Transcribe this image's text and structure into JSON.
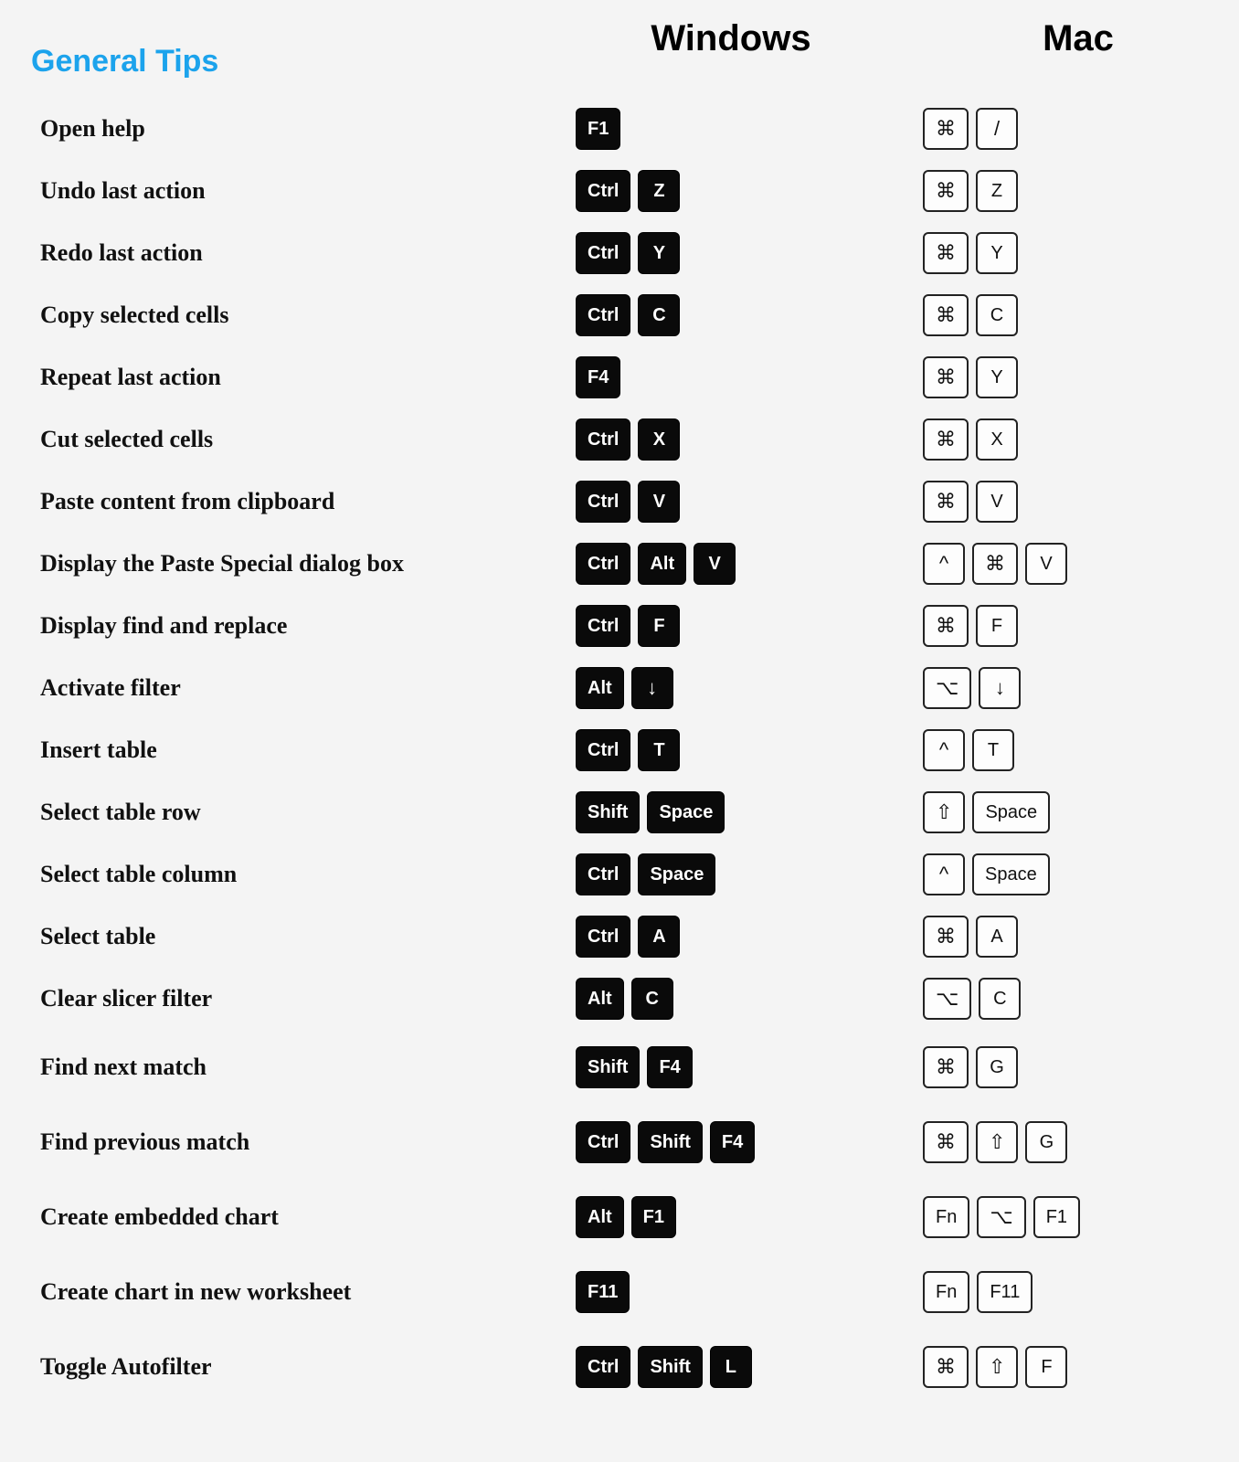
{
  "headers": {
    "section": "General Tips",
    "windows": "Windows",
    "mac": "Mac"
  },
  "rows": [
    {
      "label": "Open help",
      "win": [
        "F1"
      ],
      "mac": [
        "⌘",
        "/"
      ]
    },
    {
      "label": "Undo last action",
      "win": [
        "Ctrl",
        "Z"
      ],
      "mac": [
        "⌘",
        "Z"
      ]
    },
    {
      "label": "Redo last action",
      "win": [
        "Ctrl",
        "Y"
      ],
      "mac": [
        "⌘",
        "Y"
      ]
    },
    {
      "label": "Copy selected cells",
      "win": [
        "Ctrl",
        "C"
      ],
      "mac": [
        "⌘",
        "C"
      ]
    },
    {
      "label": "Repeat last action",
      "win": [
        "F4"
      ],
      "mac": [
        "⌘",
        "Y"
      ]
    },
    {
      "label": "Cut selected cells",
      "win": [
        "Ctrl",
        "X"
      ],
      "mac": [
        "⌘",
        "X"
      ]
    },
    {
      "label": "Paste content from clipboard",
      "win": [
        "Ctrl",
        "V"
      ],
      "mac": [
        "⌘",
        "V"
      ]
    },
    {
      "label": "Display the Paste Special dialog box",
      "win": [
        "Ctrl",
        "Alt",
        "V"
      ],
      "mac": [
        "^",
        "⌘",
        "V"
      ]
    },
    {
      "label": "Display find and replace",
      "win": [
        "Ctrl",
        "F"
      ],
      "mac": [
        "⌘",
        "F"
      ]
    },
    {
      "label": "Activate filter",
      "win": [
        "Alt",
        "↓"
      ],
      "mac": [
        "⌥",
        "↓"
      ]
    },
    {
      "label": "Insert table",
      "win": [
        "Ctrl",
        "T"
      ],
      "mac": [
        "^",
        "T"
      ]
    },
    {
      "label": "Select table row",
      "win": [
        "Shift",
        "Space"
      ],
      "mac": [
        "⇧",
        "Space"
      ]
    },
    {
      "label": "Select table column",
      "win": [
        "Ctrl",
        "Space"
      ],
      "mac": [
        "^",
        "Space"
      ]
    },
    {
      "label": "Select table",
      "win": [
        "Ctrl",
        "A"
      ],
      "mac": [
        "⌘",
        "A"
      ]
    },
    {
      "label": "Clear slicer filter",
      "win": [
        "Alt",
        "C"
      ],
      "mac": [
        "⌥",
        "C"
      ]
    },
    {
      "label": "Find next match",
      "win": [
        "Shift",
        "F4"
      ],
      "mac": [
        "⌘",
        "G"
      ],
      "tall": true
    },
    {
      "label": "Find previous match",
      "win": [
        "Ctrl",
        "Shift",
        "F4"
      ],
      "mac": [
        "⌘",
        "⇧",
        "G"
      ],
      "tall": true
    },
    {
      "label": "Create embedded chart",
      "win": [
        "Alt",
        "F1"
      ],
      "mac": [
        "Fn",
        "⌥",
        "F1"
      ],
      "tall": true
    },
    {
      "label": "Create chart in new worksheet",
      "win": [
        "F11"
      ],
      "mac": [
        "Fn",
        "F11"
      ],
      "tall": true
    },
    {
      "label": "Toggle Autofilter",
      "win": [
        "Ctrl",
        "Shift",
        "L"
      ],
      "mac": [
        "⌘",
        "⇧",
        "F"
      ],
      "tall": true
    }
  ]
}
